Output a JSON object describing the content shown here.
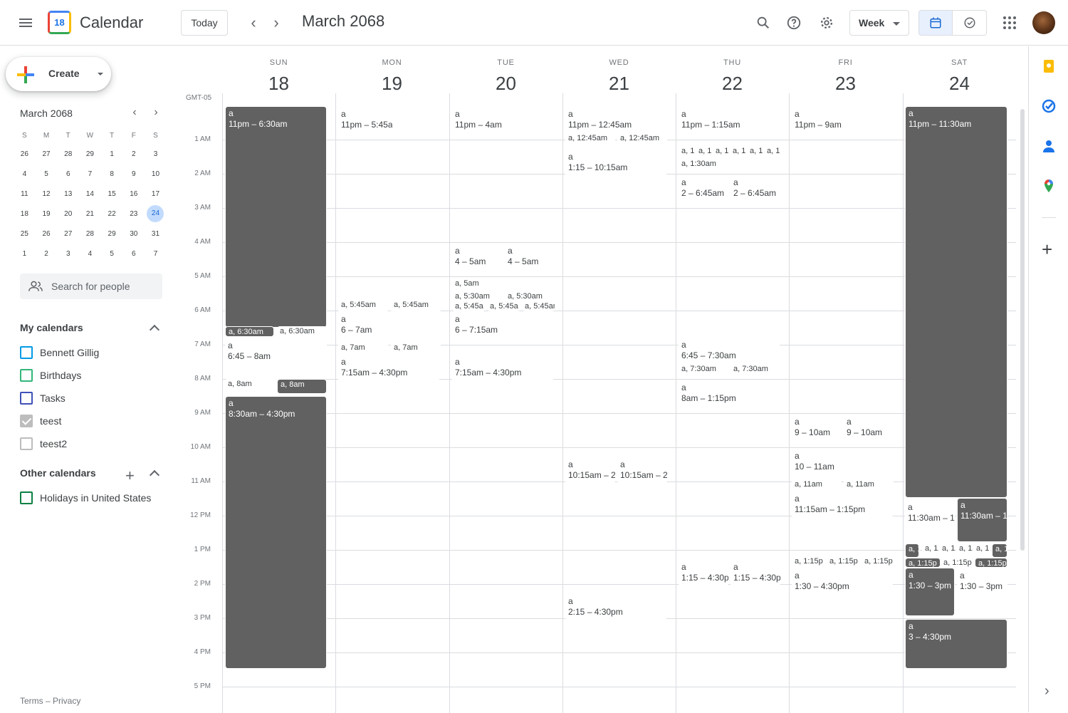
{
  "header": {
    "app_title": "Calendar",
    "logo_day": "18",
    "today_label": "Today",
    "month_title": "March 2068",
    "view_label": "Week"
  },
  "sidebar": {
    "create_label": "Create",
    "mini_cal": {
      "title": "March 2068",
      "weekdays": [
        "S",
        "M",
        "T",
        "W",
        "T",
        "F",
        "S"
      ],
      "weeks": [
        [
          "26",
          "27",
          "28",
          "29",
          "1",
          "2",
          "3"
        ],
        [
          "4",
          "5",
          "6",
          "7",
          "8",
          "9",
          "10"
        ],
        [
          "11",
          "12",
          "13",
          "14",
          "15",
          "16",
          "17"
        ],
        [
          "18",
          "19",
          "20",
          "21",
          "22",
          "23",
          "24"
        ],
        [
          "25",
          "26",
          "27",
          "28",
          "29",
          "30",
          "31"
        ],
        [
          "1",
          "2",
          "3",
          "4",
          "5",
          "6",
          "7"
        ]
      ],
      "selected": "24"
    },
    "search_people_placeholder": "Search for people",
    "my_calendars_title": "My calendars",
    "my_calendars": [
      {
        "label": "Bennett Gillig",
        "color": "#039be5",
        "checked": false
      },
      {
        "label": "Birthdays",
        "color": "#33b679",
        "checked": false
      },
      {
        "label": "Tasks",
        "color": "#3f51b5",
        "checked": false
      },
      {
        "label": "teest",
        "color": "#bdbdbd",
        "checked": true
      },
      {
        "label": "teest2",
        "color": "#bdbdbd",
        "checked": false
      }
    ],
    "other_calendars_title": "Other calendars",
    "other_calendars": [
      {
        "label": "Holidays in United States",
        "color": "#0b8043",
        "checked": false
      }
    ],
    "footer": "Terms – Privacy"
  },
  "grid": {
    "timezone": "GMT-05",
    "days": [
      {
        "dow": "SUN",
        "num": "18"
      },
      {
        "dow": "MON",
        "num": "19"
      },
      {
        "dow": "TUE",
        "num": "20"
      },
      {
        "dow": "WED",
        "num": "21"
      },
      {
        "dow": "THU",
        "num": "22"
      },
      {
        "dow": "FRI",
        "num": "23"
      },
      {
        "dow": "SAT",
        "num": "24"
      }
    ],
    "hours": [
      "1 AM",
      "2 AM",
      "3 AM",
      "4 AM",
      "5 AM",
      "6 AM",
      "7 AM",
      "8 AM",
      "9 AM",
      "10 AM",
      "11 AM",
      "12 PM",
      "1 PM",
      "2 PM",
      "3 PM",
      "4 PM",
      "5 PM"
    ]
  },
  "events": [
    {
      "day": 0,
      "title": "a",
      "time": "11pm – 6:30am",
      "dark": true
    },
    {
      "day": 0,
      "title": "a, 6:30am",
      "time": "",
      "dark": true
    },
    {
      "day": 0,
      "title": "a, 6:30am",
      "time": "",
      "dark": false
    },
    {
      "day": 0,
      "title": "a",
      "time": "6:45 – 8am",
      "dark": false
    },
    {
      "day": 0,
      "title": "a, 8am",
      "time": "",
      "dark": false
    },
    {
      "day": 0,
      "title": "a, 8am",
      "time": "",
      "dark": true
    },
    {
      "day": 0,
      "title": "a",
      "time": "8:30am – 4:30pm",
      "dark": true
    },
    {
      "day": 1,
      "title": "a",
      "time": "11pm – 5:45am",
      "dark": false
    },
    {
      "day": 1,
      "title": "a, 5:45am",
      "time": "",
      "dark": false
    },
    {
      "day": 1,
      "title": "a, 5:45am",
      "time": "",
      "dark": false
    },
    {
      "day": 1,
      "title": "a",
      "time": "6 – 7am",
      "dark": false
    },
    {
      "day": 1,
      "title": "a, 7am",
      "time": "",
      "dark": false
    },
    {
      "day": 1,
      "title": "a, 7am",
      "time": "",
      "dark": false
    },
    {
      "day": 1,
      "title": "a",
      "time": "7:15am – 4:30pm",
      "dark": false
    },
    {
      "day": 2,
      "title": "a",
      "time": "11pm – 4am",
      "dark": false
    },
    {
      "day": 2,
      "title": "a",
      "time": "4 – 5am",
      "dark": false
    },
    {
      "day": 2,
      "title": "a",
      "time": "4 – 5am",
      "dark": false
    },
    {
      "day": 2,
      "title": "a, 5am",
      "time": "",
      "dark": false
    },
    {
      "day": 2,
      "title": "a, 5:30am",
      "time": "",
      "dark": false
    },
    {
      "day": 2,
      "title": "a, 5:30am",
      "time": "",
      "dark": false
    },
    {
      "day": 2,
      "title": "a, 5:45a",
      "time": "",
      "dark": false
    },
    {
      "day": 2,
      "title": "a, 5:45a",
      "time": "",
      "dark": false
    },
    {
      "day": 2,
      "title": "a, 5:45am",
      "time": "",
      "dark": false
    },
    {
      "day": 2,
      "title": "a",
      "time": "6 – 7:15am",
      "dark": false
    },
    {
      "day": 2,
      "title": "a",
      "time": "7:15am – 4:30pm",
      "dark": false
    },
    {
      "day": 3,
      "title": "a",
      "time": "11pm – 12:45am",
      "dark": false
    },
    {
      "day": 3,
      "title": "a, 12:45am",
      "time": "",
      "dark": false
    },
    {
      "day": 3,
      "title": "a, 12:45am",
      "time": "",
      "dark": false
    },
    {
      "day": 3,
      "title": "a",
      "time": "1:15 – 10:15am",
      "dark": false
    },
    {
      "day": 3,
      "title": "a",
      "time": "10:15am – 2",
      "dark": false
    },
    {
      "day": 3,
      "title": "a",
      "time": "10:15am – 2",
      "dark": false
    },
    {
      "day": 3,
      "title": "a",
      "time": "2:15 – 4:30pm",
      "dark": false
    },
    {
      "day": 4,
      "title": "a",
      "time": "11pm – 1:15am",
      "dark": false
    },
    {
      "day": 4,
      "title": "a, 1",
      "time": "",
      "dark": false
    },
    {
      "day": 4,
      "title": "a, 1",
      "time": "",
      "dark": false
    },
    {
      "day": 4,
      "title": "a, 1",
      "time": "",
      "dark": false
    },
    {
      "day": 4,
      "title": "a, 1",
      "time": "",
      "dark": false
    },
    {
      "day": 4,
      "title": "a, 1",
      "time": "",
      "dark": false
    },
    {
      "day": 4,
      "title": "a, 1",
      "time": "",
      "dark": false
    },
    {
      "day": 4,
      "title": "a, 1:30am",
      "time": "",
      "dark": false
    },
    {
      "day": 4,
      "title": "a",
      "time": "2 – 6:45am",
      "dark": false
    },
    {
      "day": 4,
      "title": "a",
      "time": "2 – 6:45am",
      "dark": false
    },
    {
      "day": 4,
      "title": "a",
      "time": "6:45 – 7:30am",
      "dark": false
    },
    {
      "day": 4,
      "title": "a, 7:30am",
      "time": "",
      "dark": false
    },
    {
      "day": 4,
      "title": "a, 7:30am",
      "time": "",
      "dark": false
    },
    {
      "day": 4,
      "title": "a",
      "time": "8am – 1:15pm",
      "dark": false
    },
    {
      "day": 4,
      "title": "a",
      "time": "1:15 – 4:30p",
      "dark": false
    },
    {
      "day": 4,
      "title": "a",
      "time": "1:15 – 4:30p",
      "dark": false
    },
    {
      "day": 5,
      "title": "a",
      "time": "11pm – 9am",
      "dark": false
    },
    {
      "day": 5,
      "title": "a",
      "time": "9 – 10am",
      "dark": false
    },
    {
      "day": 5,
      "title": "a",
      "time": "9 – 10am",
      "dark": false
    },
    {
      "day": 5,
      "title": "a",
      "time": "10 – 11am",
      "dark": false
    },
    {
      "day": 5,
      "title": "a, 11am",
      "time": "",
      "dark": false
    },
    {
      "day": 5,
      "title": "a, 11am",
      "time": "",
      "dark": false
    },
    {
      "day": 5,
      "title": "a",
      "time": "11:15am – 1:15pm",
      "dark": false
    },
    {
      "day": 5,
      "title": "a, 1:15p",
      "time": "",
      "dark": false
    },
    {
      "day": 5,
      "title": "a, 1:15p",
      "time": "",
      "dark": false
    },
    {
      "day": 5,
      "title": "a, 1:15p",
      "time": "",
      "dark": false
    },
    {
      "day": 5,
      "title": "a",
      "time": "1:30 – 4:30pm",
      "dark": false
    },
    {
      "day": 6,
      "title": "a",
      "time": "11pm – 11:30am",
      "dark": true
    },
    {
      "day": 6,
      "title": "a",
      "time": "11:30am – 1",
      "dark": false
    },
    {
      "day": 6,
      "title": "a",
      "time": "11:30am – 1",
      "dark": true
    },
    {
      "day": 6,
      "title": "a, 1",
      "time": "",
      "dark": true
    },
    {
      "day": 6,
      "title": "a, 1",
      "time": "",
      "dark": false
    },
    {
      "day": 6,
      "title": "a, 1",
      "time": "",
      "dark": false
    },
    {
      "day": 6,
      "title": "a, 1",
      "time": "",
      "dark": false
    },
    {
      "day": 6,
      "title": "a, 1",
      "time": "",
      "dark": false
    },
    {
      "day": 6,
      "title": "a, 1",
      "time": "",
      "dark": true
    },
    {
      "day": 6,
      "title": "a, 1:15p",
      "time": "",
      "dark": true
    },
    {
      "day": 6,
      "title": "a, 1:15p",
      "time": "",
      "dark": false
    },
    {
      "day": 6,
      "title": "a, 1:15p",
      "time": "",
      "dark": true
    },
    {
      "day": 6,
      "title": "a",
      "time": "1:30 – 3pm",
      "dark": true
    },
    {
      "day": 6,
      "title": "a",
      "time": "1:30 – 3pm",
      "dark": false
    },
    {
      "day": 6,
      "title": "a",
      "time": "3 – 4:30pm",
      "dark": true
    }
  ]
}
